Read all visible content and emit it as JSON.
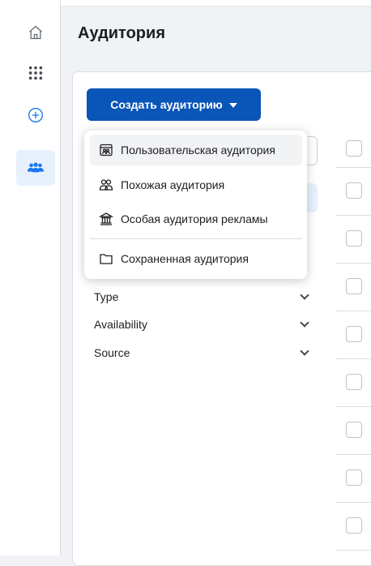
{
  "page_title": "Аудитория",
  "create_button": {
    "label": "Создать аудиторию"
  },
  "create_menu": {
    "items": [
      {
        "label": "Пользовательская аудитория",
        "icon": "custom-audience-icon"
      },
      {
        "label": "Похожая аудитория",
        "icon": "lookalike-people-icon"
      },
      {
        "label": "Особая аудитория рекламы",
        "icon": "bank-building-icon"
      },
      {
        "label": "Сохраненная аудитория",
        "icon": "folder-icon"
      }
    ]
  },
  "filters": [
    {
      "label": "Type"
    },
    {
      "label": "Availability"
    },
    {
      "label": "Source"
    }
  ],
  "rail": {
    "items": [
      "home-icon",
      "apps-grid-icon",
      "add-circle-icon",
      "audience-people-icon"
    ],
    "active": "audience-people-icon",
    "accent": "#1877f2"
  },
  "colors": {
    "primary_button": "#0a55b8",
    "accent": "#1877f2"
  }
}
